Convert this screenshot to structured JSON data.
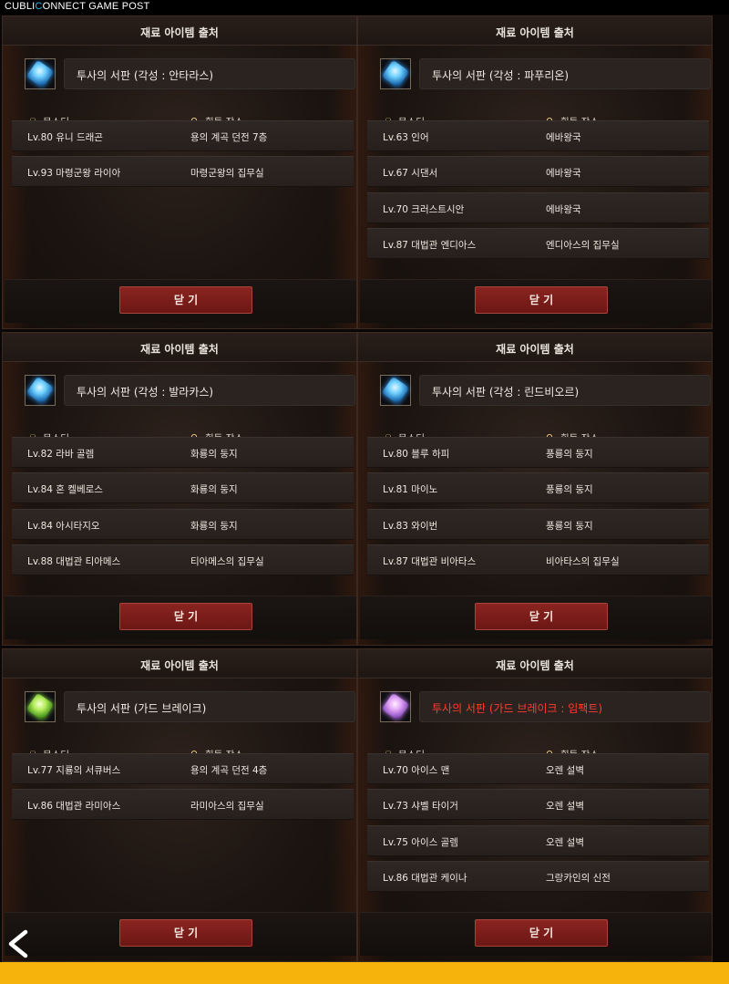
{
  "brand": {
    "prefix": "CUBLI",
    "highlight": "C",
    "suffix": "ONNECT GAME POST"
  },
  "panels": [
    {
      "title": "재료 아이템 출처",
      "item_name": "투사의 서판 (각성 : 안타라스)",
      "item_name_color": "white",
      "gem": "blue",
      "col_monster": "몬스터",
      "col_location": "획득 장소",
      "rows": [
        {
          "monster": "Lv.80 유니 드래곤",
          "location": "용의 계곡 던전 7층"
        },
        {
          "monster": "Lv.93 마령군왕 라이아",
          "location": "마령군왕의 집무실"
        }
      ],
      "close_label": "닫 기"
    },
    {
      "title": "재료 아이템 출처",
      "item_name": "투사의 서판 (각성 : 파푸리온)",
      "item_name_color": "white",
      "gem": "blue",
      "col_monster": "몬스터",
      "col_location": "획득 장소",
      "rows": [
        {
          "monster": "Lv.63 인어",
          "location": "에바왕국"
        },
        {
          "monster": "Lv.67 시댄서",
          "location": "에바왕국"
        },
        {
          "monster": "Lv.70 크러스트시안",
          "location": "에바왕국"
        },
        {
          "monster": "Lv.87 대법관 엔디아스",
          "location": "엔디아스의 집무실"
        }
      ],
      "close_label": "닫 기"
    },
    {
      "title": "재료 아이템 출처",
      "item_name": "투사의 서판 (각성 : 발라카스)",
      "item_name_color": "white",
      "gem": "blue",
      "col_monster": "몬스터",
      "col_location": "획득 장소",
      "rows": [
        {
          "monster": "Lv.82 라바 골렘",
          "location": "화룡의 둥지"
        },
        {
          "monster": "Lv.84 혼 켈베로스",
          "location": "화룡의 둥지"
        },
        {
          "monster": "Lv.84 아시타지오",
          "location": "화룡의 둥지"
        },
        {
          "monster": "Lv.88 대법관 티아메스",
          "location": "티아메스의 집무실"
        }
      ],
      "close_label": "닫 기"
    },
    {
      "title": "재료 아이템 출처",
      "item_name": "투사의 서판 (각성 : 린드비오르)",
      "item_name_color": "white",
      "gem": "blue",
      "col_monster": "몬스터",
      "col_location": "획득 장소",
      "rows": [
        {
          "monster": "Lv.80 블루 하피",
          "location": "풍룡의 둥지"
        },
        {
          "monster": "Lv.81 마이노",
          "location": "풍룡의 둥지"
        },
        {
          "monster": "Lv.83 와이번",
          "location": "풍룡의 둥지"
        },
        {
          "monster": "Lv.87 대법관 비아타스",
          "location": "비아타스의 집무실"
        }
      ],
      "close_label": "닫 기"
    },
    {
      "title": "재료 아이템 출처",
      "item_name": "투사의 서판 (가드 브레이크)",
      "item_name_color": "white",
      "gem": "green",
      "col_monster": "몬스터",
      "col_location": "획득 장소",
      "rows": [
        {
          "monster": "Lv.77 지룡의 서큐버스",
          "location": "용의 계곡 던전 4층"
        },
        {
          "monster": "Lv.86 대법관 라미아스",
          "location": "라미아스의 집무실"
        }
      ],
      "close_label": "닫 기"
    },
    {
      "title": "재료 아이템 출처",
      "item_name": "투사의 서판 (가드 브레이크 : 임팩트)",
      "item_name_color": "red",
      "gem": "purple",
      "col_monster": "몬스터",
      "col_location": "획득 장소",
      "rows": [
        {
          "monster": "Lv.70 아이스 맨",
          "location": "오렌 설벽"
        },
        {
          "monster": "Lv.73 샤벨 타이거",
          "location": "오렌 설벽"
        },
        {
          "monster": "Lv.75 아이스 골렘",
          "location": "오렌 설벽"
        },
        {
          "monster": "Lv.86 대법관 케이나",
          "location": "그랑카인의 신전"
        }
      ],
      "close_label": "닫 기"
    }
  ],
  "icons": {
    "monster": "skull-icon",
    "location": "location-pin-icon",
    "back": "back-arrow-icon",
    "item": "gem-icon"
  },
  "colors": {
    "close_button": "#7a1d1a",
    "item_name_red": "#ff3b2e",
    "bottom_bar": "#f5b30c",
    "brand_highlight": "#26b8e8"
  }
}
